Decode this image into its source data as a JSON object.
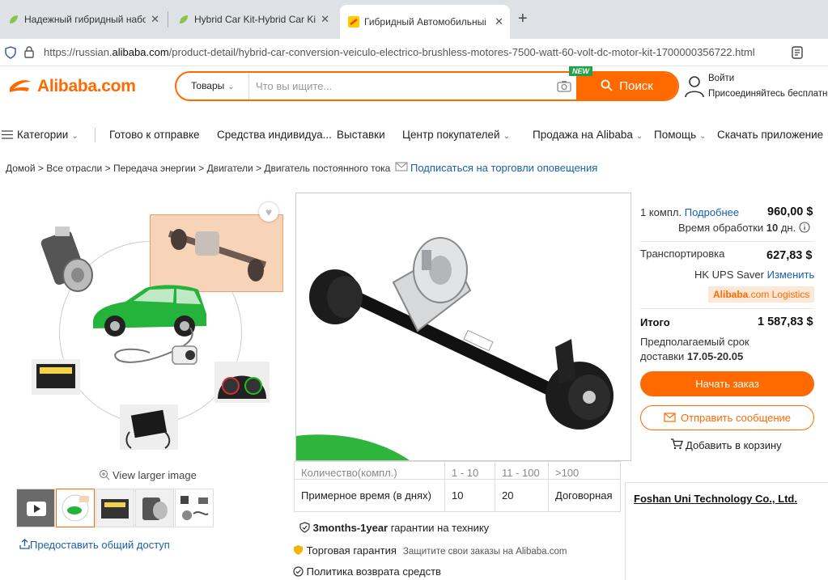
{
  "browser": {
    "tabs": [
      {
        "title": "Надежный гибридный набор д"
      },
      {
        "title": "Hybrid Car Kit-Hybrid Car Kit M"
      },
      {
        "title": "Гибридный Автомобильный П"
      }
    ],
    "url_prefix": "https://russian.",
    "url_domain": "alibaba.com",
    "url_path": "/product-detail/hybrid-car-conversion-veiculo-electrico-brushless-motores-7500-watt-60-volt-dc-motor-kit-1700000356722.html"
  },
  "header": {
    "logo_text": "Alibaba.com",
    "search_category": "Товары",
    "search_placeholder": "Что вы ищите...",
    "new_badge": "NEW",
    "search_button": "Поиск",
    "login": "Войти",
    "register": "Присоединяйтесь бесплатно"
  },
  "nav": {
    "categories": "Категории",
    "ready_to_ship": "Готово к отправке",
    "personal_protection": "Средства индивидуа...",
    "exhibitions": "Выставки",
    "buyer_center": "Центр покупателей",
    "sell": "Продажа на Alibaba",
    "help": "Помощь",
    "download_app": "Скачать приложение"
  },
  "breadcrumb": {
    "items": [
      "Домой",
      "Все отрасли",
      "Передача энергии",
      "Двигатели",
      "Двигатель постоянного тока"
    ],
    "separator": ">",
    "subscribe": "Подписаться на торговли оповещения"
  },
  "gallery": {
    "view_larger": "View larger image",
    "share": "Предоставить общий доступ"
  },
  "price_table": {
    "cut_row": [
      "Количество(компл.)",
      "1 - 10",
      "11 - 100",
      ">100"
    ],
    "time_row": [
      "Примерное время (в днях)",
      "10",
      "20",
      "Договорная"
    ]
  },
  "features": {
    "warranty_bold": "3months-1year",
    "warranty_rest": " гарантии на технику",
    "trade_assurance": "Торговая гарантия",
    "trade_assurance_note": "Защитите свои заказы на Alibaba.com",
    "return_policy": "Политика возврата средств"
  },
  "panel": {
    "qty": "1 компл.",
    "details_link": "Подробнее",
    "unit_price": "960,00 $",
    "processing_label": "Время обработки ",
    "processing_value": "10",
    "processing_unit": " дн.",
    "shipping_label": "Транспортировка",
    "shipping_price": "627,83 $",
    "shipping_method": "HK UPS Saver ",
    "change_link": "Изменить",
    "logistics_brand": "Alibaba",
    "logistics_rest": ".com Logistics",
    "total_label": "Итого",
    "total_price": "1 587,83 $",
    "delivery_label": "Предполагаемый срок",
    "delivery_label2": "доставки ",
    "delivery_dates": "17.05-20.05",
    "order_button": "Начать заказ",
    "message_button": "Отправить сообщение",
    "cart_button": "Добавить в корзину"
  },
  "supplier": {
    "name": "Foshan Uni Technology Co., Ltd."
  },
  "colors": {
    "accent": "#ff6a00",
    "link": "#1a5fad"
  }
}
